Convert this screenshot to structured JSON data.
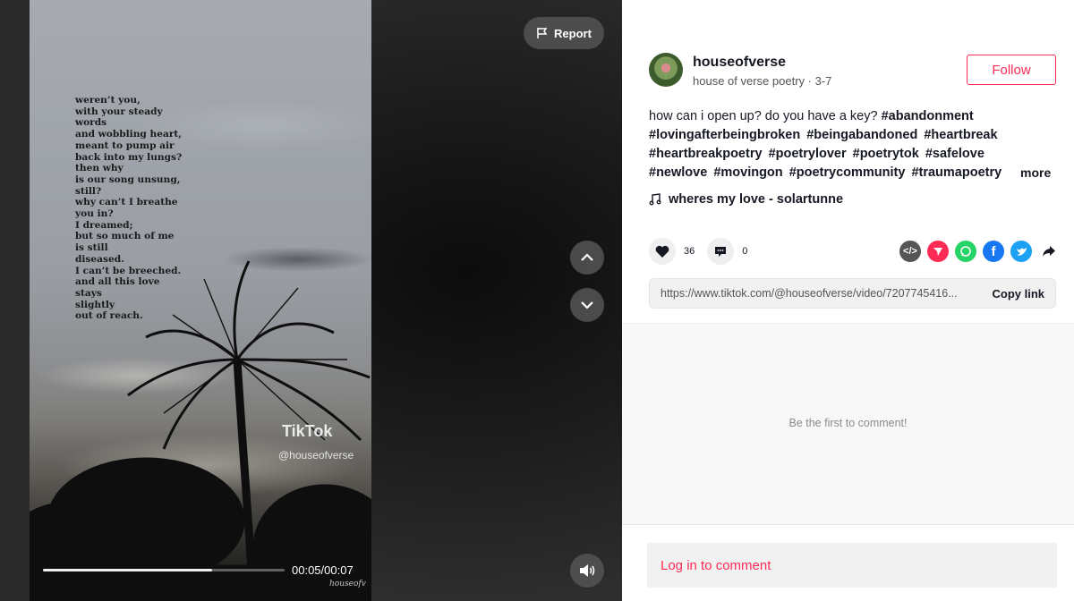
{
  "video": {
    "poem": "weren’t you,\nwith your steady\nwords\nand wobbling heart,\nmeant to pump air\nback into my lungs?\nthen why\nis our song unsung,\nstill?\nwhy can’t I breathe\nyou in?\nI dreamed;\nbut so much of me\nis still\ndiseased.\nI can’t be breeched.\nand all this love\nstays\nslightly\nout of reach.",
    "watermark_logo": "TikTok",
    "watermark_handle": "@houseofverse",
    "watermark_small": "houseofv",
    "time": "00:05/00:07",
    "progress": 0.7
  },
  "controls": {
    "report_label": "Report"
  },
  "author": {
    "username": "houseofverse",
    "subline": "house of verse poetry · 3-7",
    "follow_label": "Follow"
  },
  "description": {
    "text": "how can i open up? do you have a key?",
    "tags": [
      "#abandonment",
      "#lovingafterbeingbroken",
      "#beingabandoned",
      "#heartbreak",
      "#heartbreakpoetry",
      "#poetrylover",
      "#poetrytok",
      "#safelove",
      "#newlove",
      "#movingon",
      "#poetrycommunity",
      "#traumapoetry"
    ],
    "more_label": "more"
  },
  "music": {
    "title": "wheres my love - solartunne"
  },
  "stats": {
    "likes": "36",
    "comments": "0"
  },
  "share": {
    "colors": {
      "embed": "#555555",
      "send": "#fe2c55",
      "whatsapp": "#25d366",
      "facebook": "#1877f2",
      "twitter": "#1da1f2"
    }
  },
  "link": {
    "url": "https://www.tiktok.com/@houseofverse/video/7207745416...",
    "copy_label": "Copy link"
  },
  "comments": {
    "empty_message": "Be the first to comment!",
    "login_label": "Log in to comment"
  }
}
